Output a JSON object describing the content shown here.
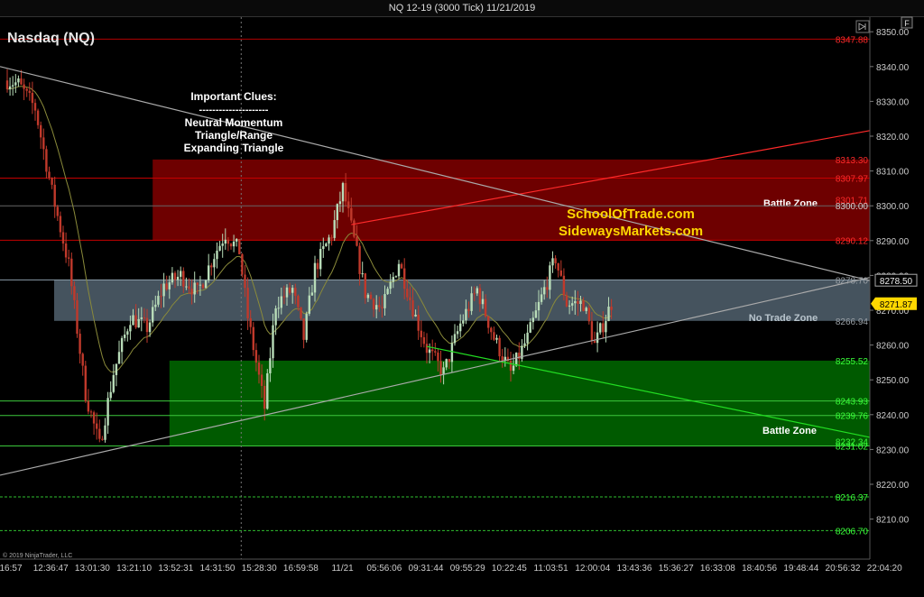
{
  "window": {
    "title": "NQ 12-19 (3000 Tick)  11/21/2019",
    "f_label": "F"
  },
  "chart_data": {
    "type": "candlestick",
    "instrument": "Nasdaq (NQ)",
    "ylim": [
      8200,
      8355
    ],
    "y_ticks": [
      8210,
      8220,
      8230,
      8240,
      8250,
      8260,
      8270,
      8280,
      8290,
      8300,
      8310,
      8320,
      8330,
      8340,
      8350
    ],
    "y_tick_labels": [
      "8210.00",
      "8220.00",
      "8230.00",
      "8240.00",
      "8250.00",
      "8260.00",
      "8270.00",
      "8280.00",
      "8290.00",
      "8300.00",
      "8310.00",
      "8320.00",
      "8330.00",
      "8340.00",
      "8350.00"
    ],
    "x_tick_labels": [
      "16:57",
      "12:36:47",
      "13:01:30",
      "13:21:10",
      "13:52:31",
      "14:31:50",
      "15:28:30",
      "16:59:58",
      "11/21",
      "05:56:06",
      "09:31:44",
      "09:55:29",
      "10:22:45",
      "11:03:51",
      "12:00:04",
      "13:43:36",
      "15:36:27",
      "16:33:08",
      "18:40:56",
      "19:48:44",
      "20:56:32",
      "22:04:20"
    ],
    "num_bars": 250,
    "session_break_bar": 83,
    "price_path": [
      [
        0,
        8336
      ],
      [
        4,
        8335
      ],
      [
        10,
        8328
      ],
      [
        16,
        8304
      ],
      [
        22,
        8283
      ],
      [
        28,
        8246
      ],
      [
        33,
        8231
      ],
      [
        38,
        8252
      ],
      [
        44,
        8268
      ],
      [
        50,
        8265
      ],
      [
        56,
        8277
      ],
      [
        62,
        8280
      ],
      [
        68,
        8275
      ],
      [
        74,
        8286
      ],
      [
        78,
        8292
      ],
      [
        83,
        8287
      ],
      [
        86,
        8268
      ],
      [
        92,
        8242
      ],
      [
        96,
        8272
      ],
      [
        102,
        8276
      ],
      [
        106,
        8262
      ],
      [
        110,
        8282
      ],
      [
        116,
        8292
      ],
      [
        120,
        8305
      ],
      [
        124,
        8290
      ],
      [
        128,
        8275
      ],
      [
        134,
        8270
      ],
      [
        140,
        8284
      ],
      [
        146,
        8268
      ],
      [
        150,
        8259
      ],
      [
        156,
        8252
      ],
      [
        162,
        8266
      ],
      [
        168,
        8276
      ],
      [
        174,
        8262
      ],
      [
        180,
        8252
      ],
      [
        186,
        8262
      ],
      [
        192,
        8276
      ],
      [
        196,
        8285
      ],
      [
        200,
        8272
      ],
      [
        206,
        8272
      ],
      [
        210,
        8260
      ],
      [
        216,
        8272
      ]
    ],
    "price_labels": [
      {
        "text": "8347.88",
        "value": 8347.88,
        "color": "#ff2a2a",
        "line_color": "#b30000"
      },
      {
        "text": "8313.30",
        "value": 8313.3,
        "color": "#ff2a2a",
        "line_color": null
      },
      {
        "text": "8307.97",
        "value": 8307.97,
        "color": "#ff2a2a",
        "line_color": "#c40000"
      },
      {
        "text": "8301.71",
        "value": 8301.71,
        "color": "#ff2a2a",
        "line_color": null
      },
      {
        "text": "8300.00",
        "value": 8300.0,
        "color": "#cfcfcf",
        "line_color": "#666666"
      },
      {
        "text": "8290.12",
        "value": 8290.12,
        "color": "#ff2a2a",
        "line_color": "#c40000"
      },
      {
        "text": "8278.70",
        "value": 8278.7,
        "color": "#9aa0a6",
        "line_color": "#8a9aa8"
      },
      {
        "text": "8266.94",
        "value": 8266.94,
        "color": "#9aa0a6",
        "line_color": null
      },
      {
        "text": "8255.52",
        "value": 8255.52,
        "color": "#39ff39",
        "line_color": null
      },
      {
        "text": "8243.93",
        "value": 8243.93,
        "color": "#39ff39",
        "line_color": "#3cc83c"
      },
      {
        "text": "8239.76",
        "value": 8239.76,
        "color": "#39ff39",
        "line_color": "#3cc83c"
      },
      {
        "text": "8232.34",
        "value": 8232.34,
        "color": "#39ff39",
        "line_color": null
      },
      {
        "text": "8231.02",
        "value": 8231.02,
        "color": "#39ff39",
        "line_color": "#3cc83c"
      },
      {
        "text": "8216.37",
        "value": 8216.37,
        "color": "#39ff39",
        "line_color": "#2fbf2f"
      },
      {
        "text": "8206.70",
        "value": 8206.7,
        "color": "#39ff39",
        "line_color": "#2fbf2f"
      }
    ],
    "current_price": {
      "text": "8271.87",
      "value": 8271.87,
      "color": "#ffd700"
    },
    "other_price": {
      "text": "8278.50",
      "value": 8278.5
    },
    "zones": [
      {
        "name": "Battle Zone",
        "low": 8290.12,
        "high": 8313.3,
        "color": "#7a0000",
        "label_color": "#ffffff"
      },
      {
        "name": "No Trade Zone",
        "low": 8266.94,
        "high": 8278.7,
        "color": "#7d97ab",
        "label_color": "#b8c4cc"
      },
      {
        "name": "Battle Zone",
        "low": 8231.02,
        "high": 8255.52,
        "color": "#006400",
        "label_color": "#ffffff"
      }
    ],
    "trendlines": [
      {
        "name": "upper-red-trendline",
        "from": [
          123,
          8294.6
        ],
        "to": [
          280,
          8321.6
        ],
        "color": "#ff2a2a"
      },
      {
        "name": "lower-green-trendline",
        "from": [
          150,
          8259.6
        ],
        "to": [
          280,
          8233.5
        ],
        "color": "#22dd22"
      },
      {
        "name": "descending-white-trendline",
        "from": [
          0,
          8340
        ],
        "to": [
          280,
          8278.5
        ],
        "color": "#aaaaaa"
      },
      {
        "name": "ascending-white-trendline",
        "from": [
          0,
          8222.6
        ],
        "to": [
          280,
          8279.4
        ],
        "color": "#aaaaaa"
      }
    ],
    "clues": {
      "heading": "Important Clues:",
      "rule": "---------------------",
      "items": [
        "Neutral Momentum",
        "Triangle/Range",
        "Expanding Triangle"
      ]
    },
    "watermark": {
      "line1": "SchoolOfTrade.com",
      "line2": "SidewaysMarkets.com",
      "color": "#ffd700"
    },
    "copyright": "© 2019 NinjaTrader, LLC",
    "colors": {
      "up_candle": "#b8dcb8",
      "down_candle": "#c0392b",
      "ma_line": "#8a8a3a"
    }
  }
}
